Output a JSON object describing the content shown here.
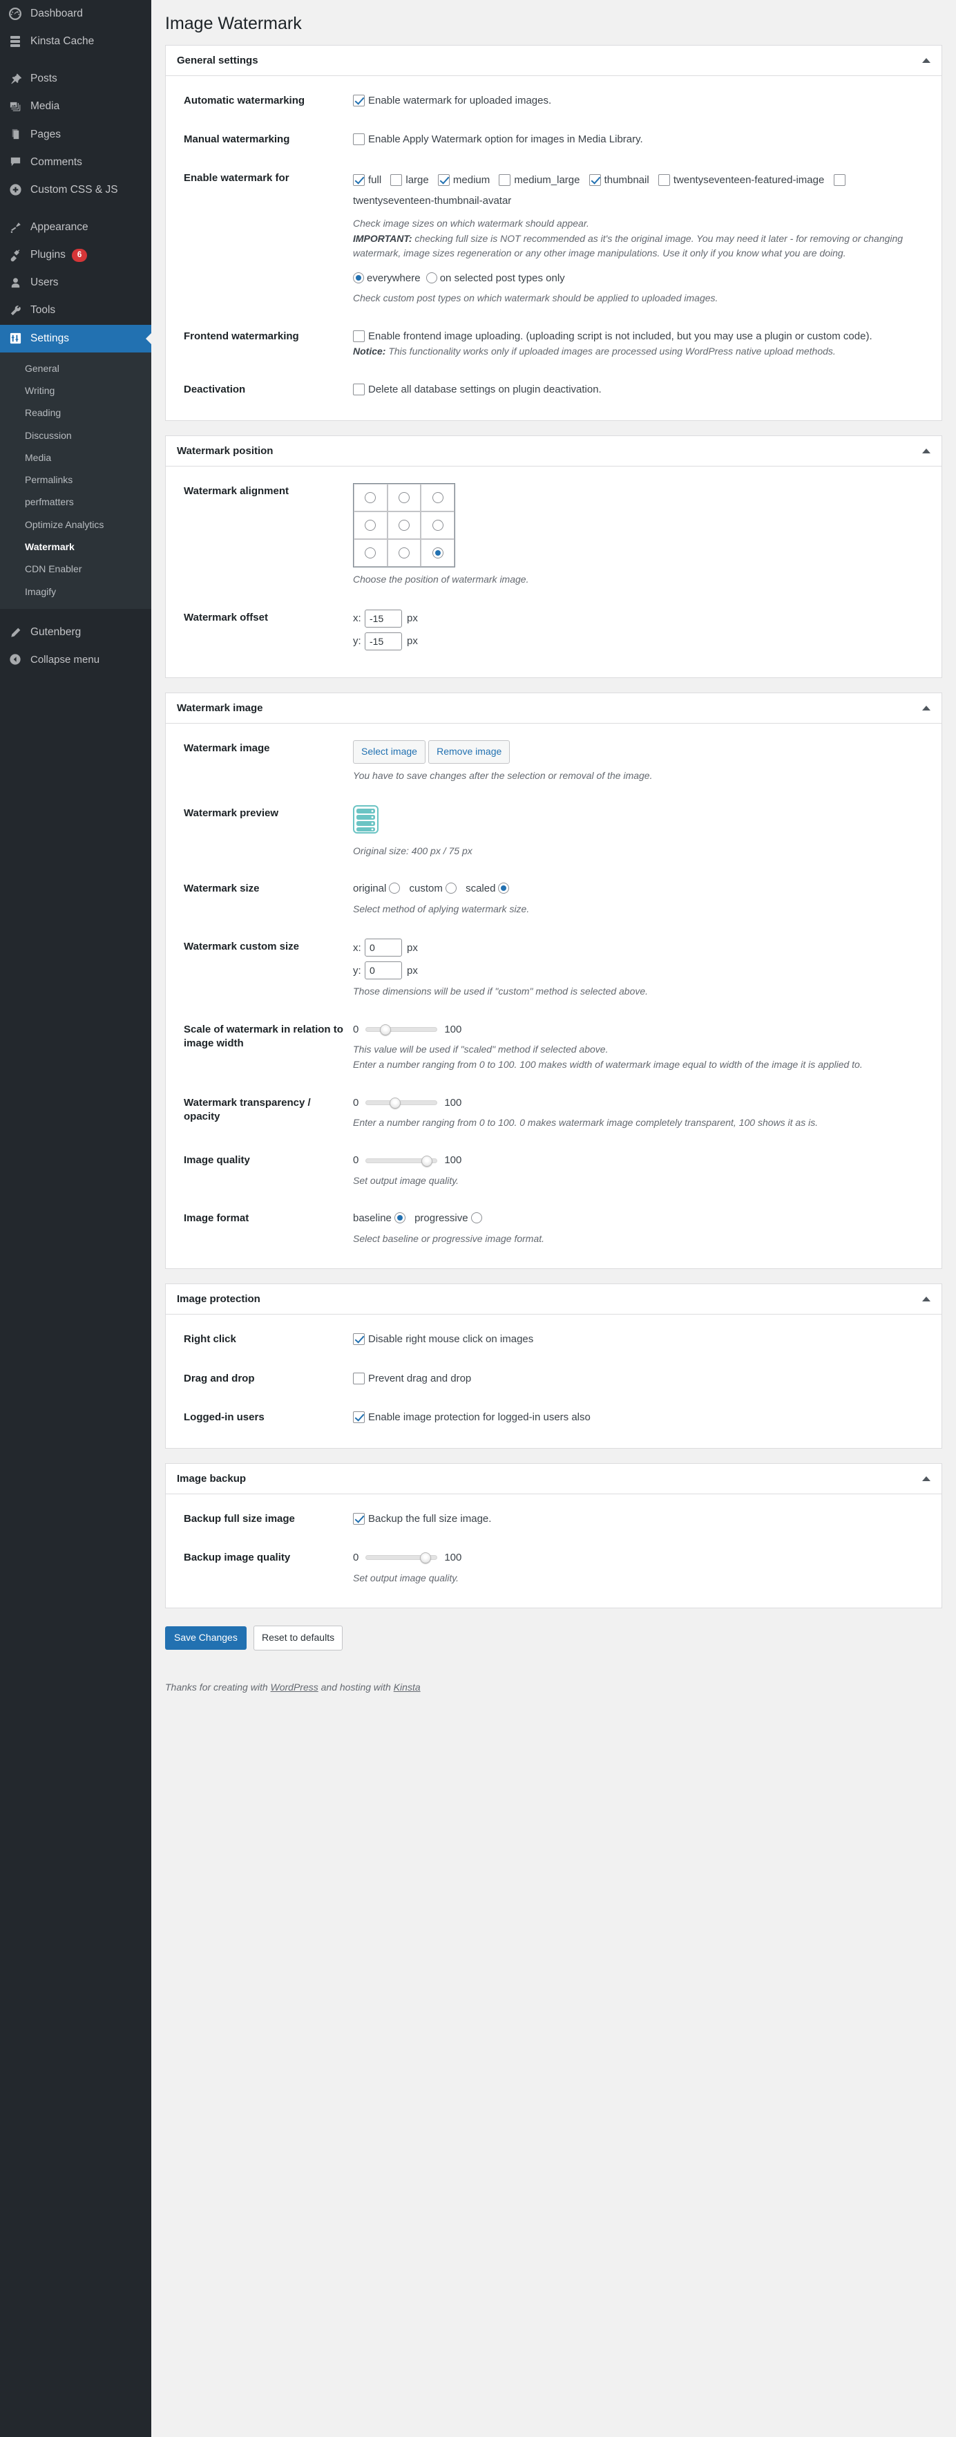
{
  "sidebar": {
    "top_items": [
      {
        "label": "Dashboard",
        "icon": "dashboard-icon",
        "badge": null,
        "current": false,
        "sep_after": true
      },
      {
        "label": "Kinsta Cache",
        "icon": "server-icon",
        "badge": null,
        "current": false,
        "sep_after": true
      },
      {
        "label": "Posts",
        "icon": "pin-icon",
        "badge": null,
        "current": false,
        "sep_after": false
      },
      {
        "label": "Media",
        "icon": "media-icon",
        "badge": null,
        "current": false,
        "sep_after": false
      },
      {
        "label": "Pages",
        "icon": "pages-icon",
        "badge": null,
        "current": false,
        "sep_after": false
      },
      {
        "label": "Comments",
        "icon": "comments-icon",
        "badge": null,
        "current": false,
        "sep_after": false
      },
      {
        "label": "Custom CSS & JS",
        "icon": "plus-circle-icon",
        "badge": null,
        "current": false,
        "sep_after": true
      },
      {
        "label": "Appearance",
        "icon": "brush-icon",
        "badge": null,
        "current": false,
        "sep_after": false
      },
      {
        "label": "Plugins",
        "icon": "plug-icon",
        "badge": "6",
        "current": false,
        "sep_after": false
      },
      {
        "label": "Users",
        "icon": "user-icon",
        "badge": null,
        "current": false,
        "sep_after": false
      },
      {
        "label": "Tools",
        "icon": "wrench-icon",
        "badge": null,
        "current": false,
        "sep_after": false
      },
      {
        "label": "Settings",
        "icon": "settings-icon",
        "badge": null,
        "current": true,
        "sep_after": false
      }
    ],
    "submenu": [
      {
        "label": "General",
        "current": false
      },
      {
        "label": "Writing",
        "current": false
      },
      {
        "label": "Reading",
        "current": false
      },
      {
        "label": "Discussion",
        "current": false
      },
      {
        "label": "Media",
        "current": false
      },
      {
        "label": "Permalinks",
        "current": false
      },
      {
        "label": "perfmatters",
        "current": false
      },
      {
        "label": "Optimize Analytics",
        "current": false
      },
      {
        "label": "Watermark",
        "current": true
      },
      {
        "label": "CDN Enabler",
        "current": false
      },
      {
        "label": "Imagify",
        "current": false
      }
    ],
    "gutenberg": {
      "label": "Gutenberg",
      "icon": "pencil-icon"
    },
    "collapse": {
      "label": "Collapse menu",
      "icon": "collapse-arrow-icon"
    }
  },
  "page": {
    "title": "Image Watermark"
  },
  "general": {
    "heading": "General settings",
    "automatic": {
      "label": "Automatic watermarking",
      "checkbox_label": "Enable watermark for uploaded images.",
      "checked": true
    },
    "manual": {
      "label": "Manual watermarking",
      "checkbox_label": "Enable Apply Watermark option for images in Media Library.",
      "checked": false
    },
    "enable_for": {
      "label": "Enable watermark for",
      "sizes": [
        {
          "name": "full",
          "checked": true
        },
        {
          "name": "large",
          "checked": false
        },
        {
          "name": "medium",
          "checked": true
        },
        {
          "name": "medium_large",
          "checked": false
        },
        {
          "name": "thumbnail",
          "checked": true
        },
        {
          "name": "twentyseventeen-featured-image",
          "checked": false
        },
        {
          "name": "twentyseventeen-thumbnail-avatar",
          "checked": false
        }
      ],
      "desc_line1": "Check image sizes on which watermark should appear.",
      "desc_important_label": "IMPORTANT:",
      "desc_important": " checking full size is NOT recommended as it's the original image. You may need it later - for removing or changing watermark, image sizes regeneration or any other image manipulations. Use it only if you know what you are doing.",
      "scope_options": [
        {
          "label": "everywhere",
          "selected": true
        },
        {
          "label": "on selected post types only",
          "selected": false
        }
      ],
      "scope_desc": "Check custom post types on which watermark should be applied to uploaded images."
    },
    "frontend": {
      "label": "Frontend watermarking",
      "checkbox_label": "Enable frontend image uploading. (uploading script is not included, but you may use a plugin or custom code).",
      "checked": false,
      "notice_label": "Notice:",
      "notice_text": " This functionality works only if uploaded images are processed using WordPress native upload methods."
    },
    "deactivation": {
      "label": "Deactivation",
      "checkbox_label": "Delete all database settings on plugin deactivation.",
      "checked": false
    }
  },
  "position": {
    "heading": "Watermark position",
    "alignment": {
      "label": "Watermark alignment",
      "cells": [
        {
          "pos": "top-left",
          "selected": false
        },
        {
          "pos": "top-center",
          "selected": false
        },
        {
          "pos": "top-right",
          "selected": false
        },
        {
          "pos": "middle-left",
          "selected": false
        },
        {
          "pos": "middle-center",
          "selected": false
        },
        {
          "pos": "middle-right",
          "selected": false
        },
        {
          "pos": "bottom-left",
          "selected": false
        },
        {
          "pos": "bottom-center",
          "selected": false
        },
        {
          "pos": "bottom-right",
          "selected": true
        }
      ],
      "desc": "Choose the position of watermark image."
    },
    "offset": {
      "label": "Watermark offset",
      "x_label": "x:",
      "x_value": "-15",
      "y_label": "y:",
      "y_value": "-15",
      "unit": "px"
    }
  },
  "image": {
    "heading": "Watermark image",
    "select_row": {
      "label": "Watermark image",
      "select_button": "Select image",
      "remove_button": "Remove image",
      "desc": "You have to save changes after the selection or removal of the image."
    },
    "preview": {
      "label": "Watermark preview",
      "icon": "server-rack-icon",
      "color": "#6bc4c4",
      "desc": "Original size: 400 px / 75 px"
    },
    "size": {
      "label": "Watermark size",
      "options": [
        {
          "label": "original",
          "selected": false
        },
        {
          "label": "custom",
          "selected": false
        },
        {
          "label": "scaled",
          "selected": true
        }
      ],
      "desc": "Select method of aplying watermark size."
    },
    "custom_size": {
      "label": "Watermark custom size",
      "x_label": "x:",
      "x_value": "0",
      "y_label": "y:",
      "y_value": "0",
      "unit": "px",
      "desc": "Those dimensions will be used if \"custom\" method is selected above."
    },
    "scale": {
      "label": "Scale of watermark in relation to image width",
      "min": "0",
      "max": "100",
      "value": 22,
      "desc1": "This value will be used if \"scaled\" method if selected above.",
      "desc2": "Enter a number ranging from 0 to 100. 100 makes width of watermark image equal to width of the image it is applied to."
    },
    "transparency": {
      "label": "Watermark transparency / opacity",
      "min": "0",
      "max": "100",
      "value": 38,
      "desc": "Enter a number ranging from 0 to 100. 0 makes watermark image completely transparent, 100 shows it as is."
    },
    "quality": {
      "label": "Image quality",
      "min": "0",
      "max": "100",
      "value": 90,
      "desc": "Set output image quality."
    },
    "format": {
      "label": "Image format",
      "options": [
        {
          "label": "baseline",
          "selected": true
        },
        {
          "label": "progressive",
          "selected": false
        }
      ],
      "desc": "Select baseline or progressive image format."
    }
  },
  "protection": {
    "heading": "Image protection",
    "right_click": {
      "label": "Right click",
      "checkbox_label": "Disable right mouse click on images",
      "checked": true
    },
    "drag_drop": {
      "label": "Drag and drop",
      "checkbox_label": "Prevent drag and drop",
      "checked": false
    },
    "logged_in": {
      "label": "Logged-in users",
      "checkbox_label": "Enable image protection for logged-in users also",
      "checked": true
    }
  },
  "backup": {
    "heading": "Image backup",
    "full_size": {
      "label": "Backup full size image",
      "checkbox_label": "Backup the full size image.",
      "checked": true
    },
    "quality": {
      "label": "Backup image quality",
      "min": "0",
      "max": "100",
      "value": 88,
      "desc": "Set output image quality."
    }
  },
  "footer": {
    "save_label": "Save Changes",
    "reset_label": "Reset to defaults",
    "credit_prefix": "Thanks for creating with ",
    "credit_wordpress": "WordPress",
    "credit_middle": " and hosting with ",
    "credit_kinsta": "Kinsta"
  }
}
